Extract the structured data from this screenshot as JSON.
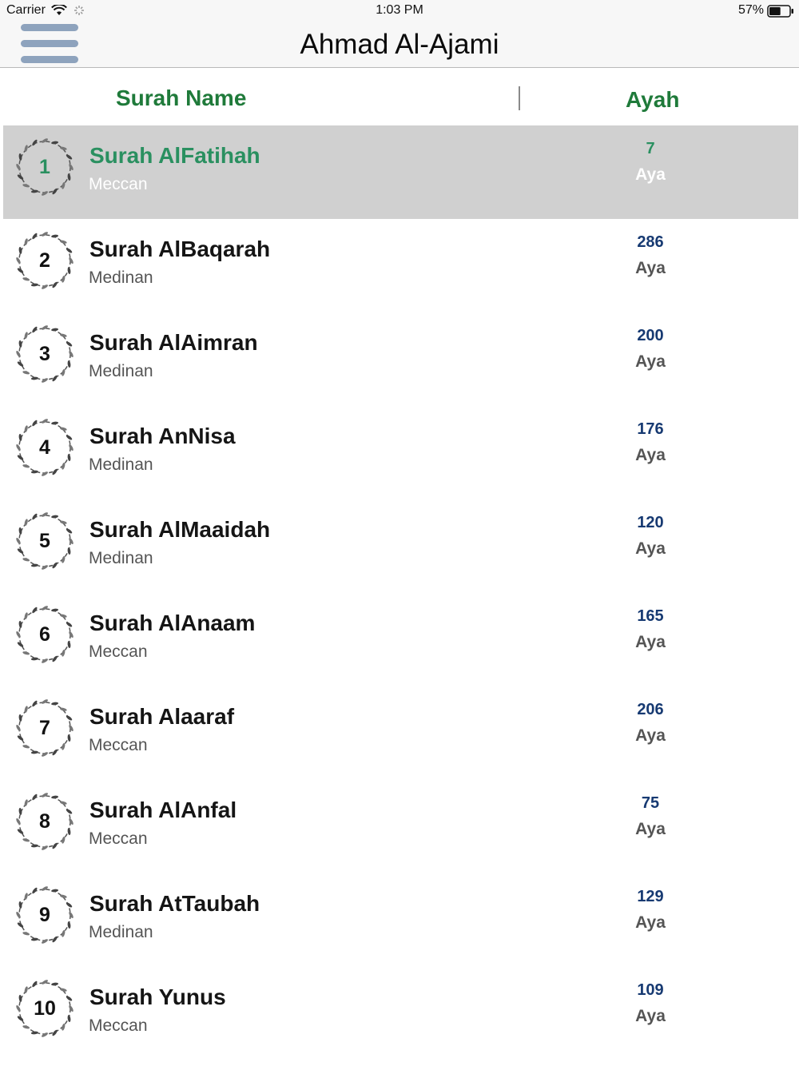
{
  "status_bar": {
    "carrier": "Carrier",
    "time": "1:03 PM",
    "battery_percent": "57%",
    "battery_level": 0.57,
    "icons": [
      "wifi-icon",
      "activity-spinner-icon",
      "battery-icon"
    ]
  },
  "nav": {
    "title": "Ahmad Al-Ajami",
    "menu_icon": "hamburger-menu-icon"
  },
  "header": {
    "surah_name": "Surah Name",
    "ayah": "Ayah"
  },
  "colors": {
    "accent_green": "#1f7a3a",
    "selected_green": "#2a9060",
    "count_blue": "#173a72",
    "selected_row_bg": "#d0d0d0"
  },
  "selected_index": 0,
  "surahs": [
    {
      "number": "1",
      "name": "Surah AlFatihah",
      "type": "Meccan",
      "ayat": "7",
      "aya_label": "Aya"
    },
    {
      "number": "2",
      "name": "Surah AlBaqarah",
      "type": "Medinan",
      "ayat": "286",
      "aya_label": "Aya"
    },
    {
      "number": "3",
      "name": "Surah AlAimran",
      "type": "Medinan",
      "ayat": "200",
      "aya_label": "Aya"
    },
    {
      "number": "4",
      "name": "Surah AnNisa",
      "type": "Medinan",
      "ayat": "176",
      "aya_label": "Aya"
    },
    {
      "number": "5",
      "name": "Surah AlMaaidah",
      "type": "Medinan",
      "ayat": "120",
      "aya_label": "Aya"
    },
    {
      "number": "6",
      "name": "Surah AlAnaam",
      "type": "Meccan",
      "ayat": "165",
      "aya_label": "Aya"
    },
    {
      "number": "7",
      "name": "Surah Alaaraf",
      "type": "Meccan",
      "ayat": "206",
      "aya_label": "Aya"
    },
    {
      "number": "8",
      "name": "Surah AlAnfal",
      "type": "Meccan",
      "ayat": "75",
      "aya_label": "Aya"
    },
    {
      "number": "9",
      "name": "Surah AtTaubah",
      "type": "Medinan",
      "ayat": "129",
      "aya_label": "Aya"
    },
    {
      "number": "10",
      "name": "Surah Yunus",
      "type": "Meccan",
      "ayat": "109",
      "aya_label": "Aya"
    }
  ]
}
